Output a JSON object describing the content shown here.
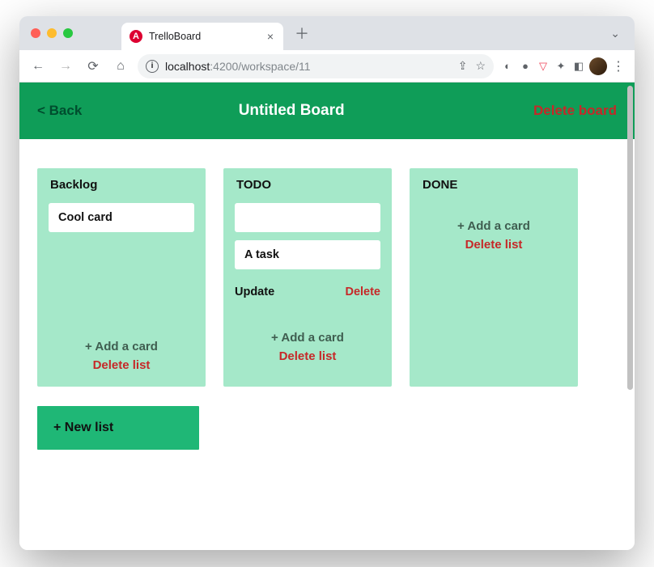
{
  "browser": {
    "tab_title": "TrelloBoard",
    "favicon_letter": "A",
    "url_host": "localhost",
    "url_port_path": ":4200/workspace/11"
  },
  "header": {
    "back_label": "< Back",
    "title": "Untitled Board",
    "delete_label": "Delete board"
  },
  "lists": [
    {
      "title": "Backlog",
      "cards": [
        {
          "text": "Cool card",
          "editing": false
        }
      ],
      "add_card_label": "+ Add a card",
      "delete_list_label": "Delete list"
    },
    {
      "title": "TODO",
      "cards": [
        {
          "text": "",
          "editing": false,
          "blank": true
        },
        {
          "text": "A task",
          "editing": true,
          "update_label": "Update",
          "delete_label": "Delete"
        }
      ],
      "add_card_label": "+ Add a card",
      "delete_list_label": "Delete list"
    },
    {
      "title": "DONE",
      "cards": [],
      "add_card_label": "+ Add a card",
      "delete_list_label": "Delete list"
    }
  ],
  "new_list_label": "+ New list",
  "colors": {
    "brand_green": "#0f9d58",
    "list_bg": "#a5e8c9",
    "new_list_bg": "#1fb776",
    "danger": "#c62828"
  }
}
